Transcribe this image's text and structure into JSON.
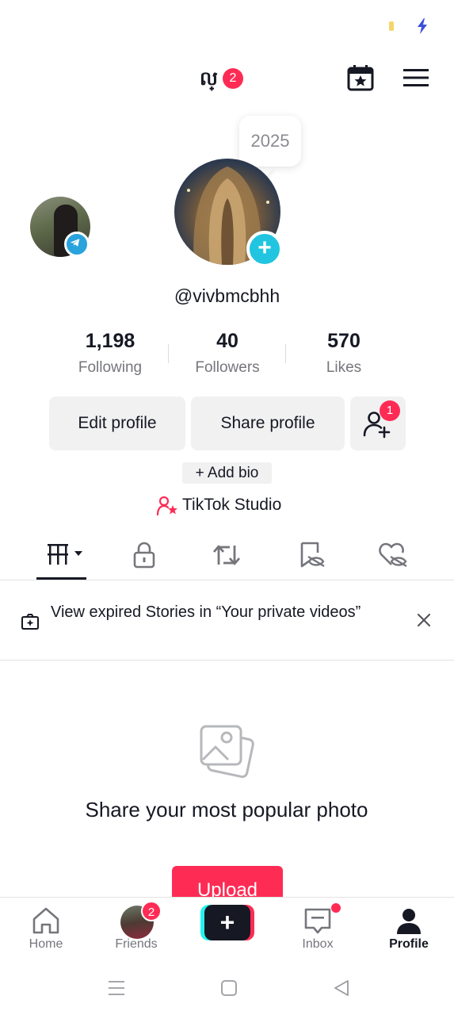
{
  "header": {
    "username": "ល្",
    "username_badge": "2",
    "calendar_icon": "calendar-star-icon",
    "menu_icon": "hamburger-menu-icon"
  },
  "profile": {
    "year_bubble": "2025",
    "handle": "@vivbmcbhh"
  },
  "stats": [
    {
      "value": "1,198",
      "label": "Following"
    },
    {
      "value": "40",
      "label": "Followers"
    },
    {
      "value": "570",
      "label": "Likes"
    }
  ],
  "actions": {
    "edit_profile": "Edit profile",
    "share_profile": "Share profile",
    "add_friend_badge": "1",
    "add_bio": "+ Add bio",
    "studio": "TikTok Studio"
  },
  "tabs": [
    {
      "icon": "grid-icon",
      "active": true
    },
    {
      "icon": "lock-icon",
      "active": false
    },
    {
      "icon": "repost-icon",
      "active": false
    },
    {
      "icon": "bookmark-hidden-icon",
      "active": false
    },
    {
      "icon": "liked-hidden-icon",
      "active": false
    }
  ],
  "banner": {
    "text": "View expired Stories in “Your private videos”"
  },
  "empty_state": {
    "title": "Share your most popular photo",
    "button": "Upload"
  },
  "bottom_nav": {
    "home": "Home",
    "friends": "Friends",
    "friends_badge": "2",
    "inbox": "Inbox",
    "profile": "Profile",
    "active": "Profile"
  },
  "colors": {
    "accent": "#fe2c55",
    "cyan": "#21c5e0",
    "text": "#161823",
    "muted": "#75767c"
  }
}
